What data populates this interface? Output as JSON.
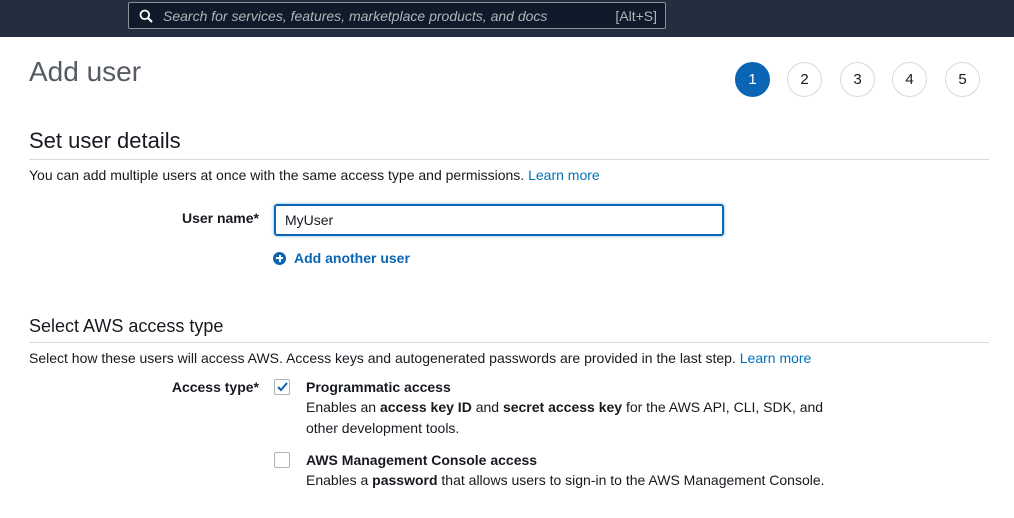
{
  "search": {
    "placeholder": "Search for services, features, marketplace products, and docs",
    "shortcut": "[Alt+S]"
  },
  "page": {
    "title": "Add user",
    "steps": [
      "1",
      "2",
      "3",
      "4",
      "5"
    ],
    "active_step": "1"
  },
  "user_details": {
    "heading": "Set user details",
    "description": "You can add multiple users at once with the same access type and permissions.",
    "learn_more": "Learn more",
    "username_label": "User name*",
    "username_value": "MyUser",
    "add_another": "Add another user"
  },
  "access_type": {
    "heading": "Select AWS access type",
    "description": "Select how these users will access AWS. Access keys and autogenerated passwords are provided in the last step.",
    "learn_more": "Learn more",
    "label": "Access type*",
    "options": [
      {
        "title": "Programmatic access",
        "checked": true,
        "desc_1": "Enables an ",
        "desc_2": "access key ID",
        "desc_3": " and ",
        "desc_4": "secret access key",
        "desc_5": " for the AWS API, CLI, SDK, and other development tools."
      },
      {
        "title": "AWS Management Console access",
        "checked": false,
        "desc_1": "Enables a ",
        "desc_2": "password",
        "desc_3": " that allows users to sign-in to the AWS Management Console."
      }
    ]
  },
  "colors": {
    "topbar": "#232f3e",
    "accent": "#0a66b4",
    "link": "#0073bb"
  }
}
